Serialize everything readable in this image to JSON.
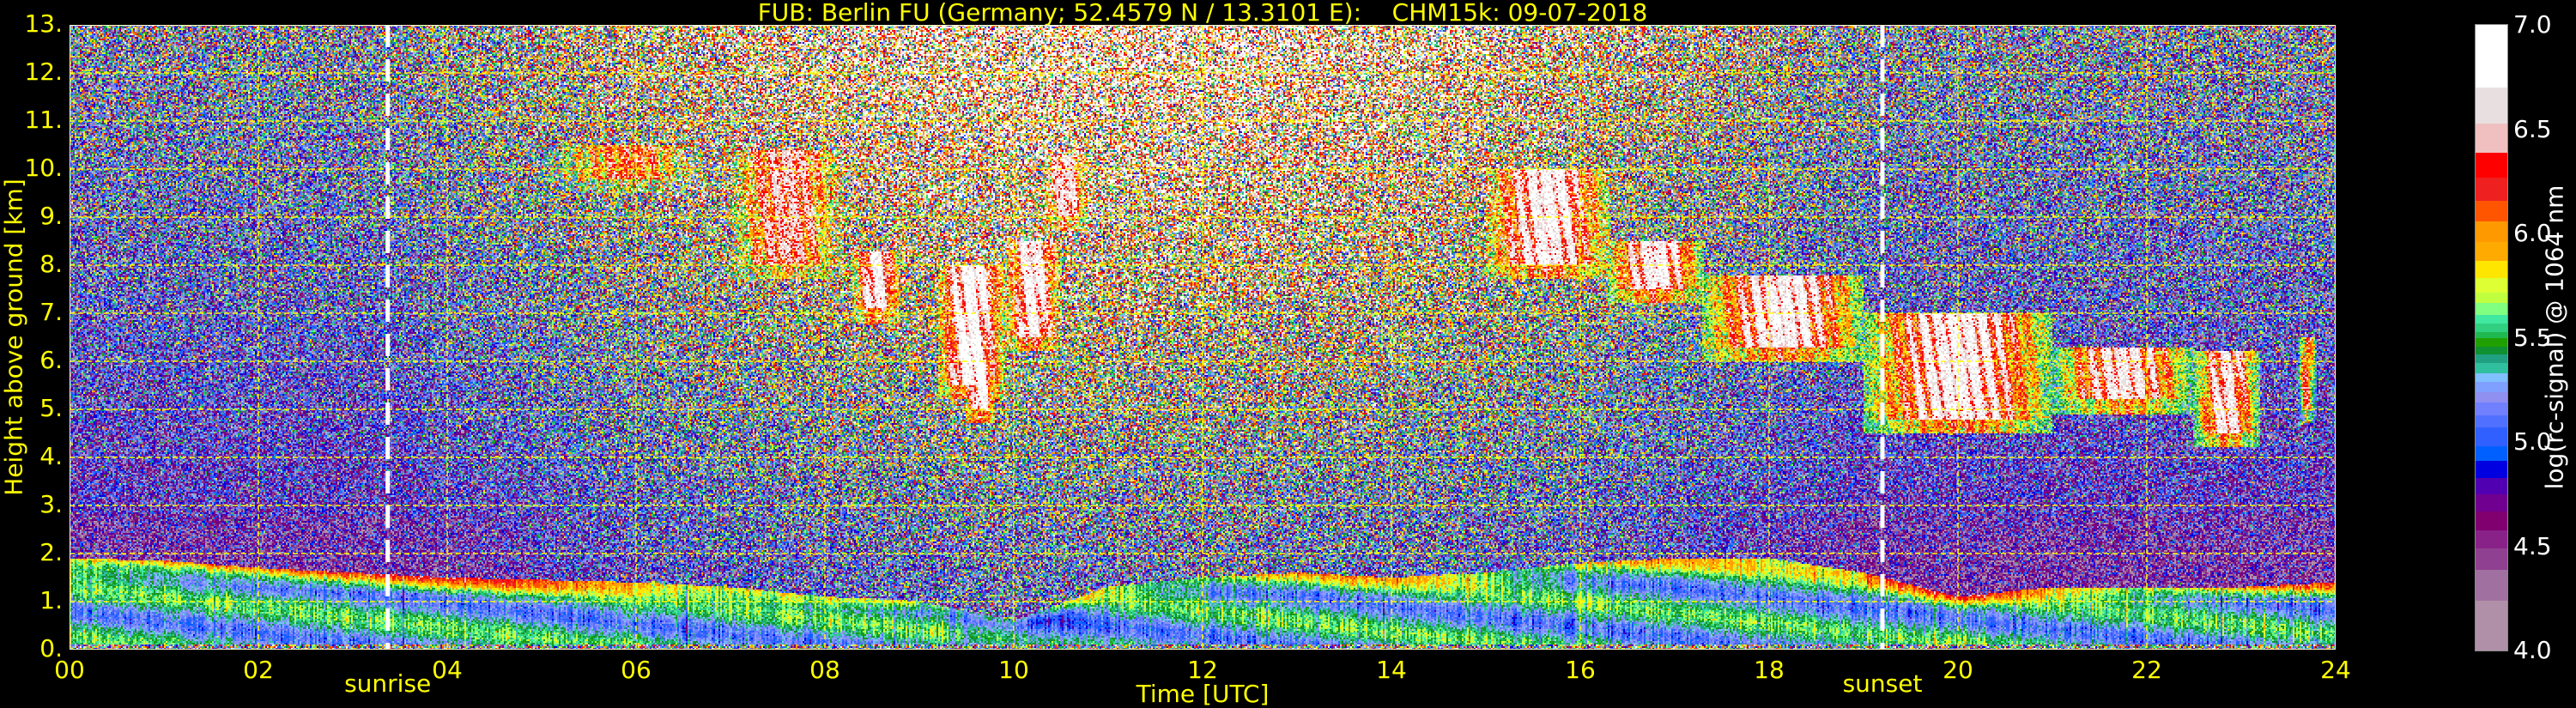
{
  "chart_data": {
    "type": "heatmap",
    "title": "FUB: Berlin FU (Germany; 52.4579 N / 13.3101 E):    CHM15k: 09-07-2018",
    "xlabel": "Time [UTC]",
    "ylabel": "Height above ground [km]",
    "xlim": [
      0,
      24
    ],
    "ylim": [
      0,
      13
    ],
    "grid": true,
    "grid_color": "#ffff00",
    "xticks": [
      {
        "value": 0,
        "label": "00"
      },
      {
        "value": 2,
        "label": "02"
      },
      {
        "value": 4,
        "label": "04"
      },
      {
        "value": 6,
        "label": "06"
      },
      {
        "value": 8,
        "label": "08"
      },
      {
        "value": 10,
        "label": "10"
      },
      {
        "value": 12,
        "label": "12"
      },
      {
        "value": 14,
        "label": "14"
      },
      {
        "value": 16,
        "label": "16"
      },
      {
        "value": 18,
        "label": "18"
      },
      {
        "value": 20,
        "label": "20"
      },
      {
        "value": 22,
        "label": "22"
      },
      {
        "value": 24,
        "label": "24"
      }
    ],
    "yticks": [
      {
        "value": 0,
        "label": "0."
      },
      {
        "value": 1,
        "label": "1."
      },
      {
        "value": 2,
        "label": "2."
      },
      {
        "value": 3,
        "label": "3."
      },
      {
        "value": 4,
        "label": "4."
      },
      {
        "value": 5,
        "label": "5."
      },
      {
        "value": 6,
        "label": "6."
      },
      {
        "value": 7,
        "label": "7."
      },
      {
        "value": 8,
        "label": "8."
      },
      {
        "value": 9,
        "label": "9."
      },
      {
        "value": 10,
        "label": "10."
      },
      {
        "value": 11,
        "label": "11."
      },
      {
        "value": 12,
        "label": "12."
      },
      {
        "value": 13,
        "label": "13."
      }
    ],
    "annotations": [
      {
        "label": "sunrise",
        "time_utc": 3.37,
        "line_color": "#ffffff"
      },
      {
        "label": "sunset",
        "time_utc": 19.2,
        "line_color": "#ffffff"
      }
    ],
    "colorbar": {
      "label": "log(rc-signal) @ 1064 nm",
      "range": [
        4.0,
        7.0
      ],
      "ticks": [
        {
          "value": 4.0,
          "label": "4.0"
        },
        {
          "value": 4.5,
          "label": "4.5"
        },
        {
          "value": 5.0,
          "label": "5.0"
        },
        {
          "value": 5.5,
          "label": "5.5"
        },
        {
          "value": 6.0,
          "label": "6.0"
        },
        {
          "value": 6.5,
          "label": "6.5"
        },
        {
          "value": 7.0,
          "label": "7.0"
        }
      ],
      "levels": [
        {
          "from": 4.0,
          "to": 4.24,
          "color": "#b090a8"
        },
        {
          "from": 4.24,
          "to": 4.39,
          "color": "#a070a0"
        },
        {
          "from": 4.39,
          "to": 4.49,
          "color": "#904090"
        },
        {
          "from": 4.49,
          "to": 4.58,
          "color": "#882288"
        },
        {
          "from": 4.58,
          "to": 4.67,
          "color": "#800070"
        },
        {
          "from": 4.67,
          "to": 4.75,
          "color": "#700090"
        },
        {
          "from": 4.75,
          "to": 4.83,
          "color": "#5000b0"
        },
        {
          "from": 4.83,
          "to": 4.91,
          "color": "#0000e0"
        },
        {
          "from": 4.91,
          "to": 4.98,
          "color": "#0060ff"
        },
        {
          "from": 4.98,
          "to": 5.07,
          "color": "#3060ff"
        },
        {
          "from": 5.07,
          "to": 5.13,
          "color": "#5070ff"
        },
        {
          "from": 5.13,
          "to": 5.19,
          "color": "#7080ff"
        },
        {
          "from": 5.19,
          "to": 5.24,
          "color": "#9090f0"
        },
        {
          "from": 5.24,
          "to": 5.29,
          "color": "#80a0ff"
        },
        {
          "from": 5.29,
          "to": 5.33,
          "color": "#80c0ff"
        },
        {
          "from": 5.33,
          "to": 5.38,
          "color": "#30c0a0"
        },
        {
          "from": 5.38,
          "to": 5.42,
          "color": "#20a080"
        },
        {
          "from": 5.42,
          "to": 5.46,
          "color": "#109030"
        },
        {
          "from": 5.46,
          "to": 5.5,
          "color": "#20a000"
        },
        {
          "from": 5.5,
          "to": 5.53,
          "color": "#20b850"
        },
        {
          "from": 5.53,
          "to": 5.57,
          "color": "#30d080"
        },
        {
          "from": 5.57,
          "to": 5.61,
          "color": "#40e8a0"
        },
        {
          "from": 5.61,
          "to": 5.67,
          "color": "#80ff80"
        },
        {
          "from": 5.67,
          "to": 5.72,
          "color": "#c0ff40"
        },
        {
          "from": 5.72,
          "to": 5.79,
          "color": "#ddff33"
        },
        {
          "from": 5.79,
          "to": 5.87,
          "color": "#ffe600"
        },
        {
          "from": 5.87,
          "to": 5.96,
          "color": "#ffaa00"
        },
        {
          "from": 5.96,
          "to": 6.06,
          "color": "#ff9900"
        },
        {
          "from": 6.06,
          "to": 6.16,
          "color": "#ff5500"
        },
        {
          "from": 6.16,
          "to": 6.27,
          "color": "#ee2020"
        },
        {
          "from": 6.27,
          "to": 6.39,
          "color": "#ff0000"
        },
        {
          "from": 6.39,
          "to": 6.53,
          "color": "#f0c0c0"
        },
        {
          "from": 6.53,
          "to": 6.7,
          "color": "#e8e0e0"
        },
        {
          "from": 6.7,
          "to": 7.0,
          "color": "#ffffff"
        }
      ]
    },
    "boundary_layer_top_km": {
      "time_utc": [
        0,
        1,
        2,
        3,
        4,
        5,
        6,
        7,
        8,
        9,
        10,
        11,
        12,
        13,
        14,
        15,
        16,
        17,
        18,
        19,
        20,
        21,
        22,
        23,
        24
      ],
      "height_km": [
        1.9,
        1.85,
        1.7,
        1.6,
        1.5,
        1.45,
        1.4,
        1.3,
        1.1,
        1.0,
        0.6,
        1.3,
        1.5,
        1.6,
        1.5,
        1.6,
        1.8,
        1.9,
        1.9,
        1.6,
        1.1,
        1.3,
        1.3,
        1.3,
        1.4
      ]
    },
    "cloud_features": [
      {
        "t0": 5.0,
        "t1": 6.8,
        "base_km": 9.8,
        "top_km": 10.5,
        "log_signal": 6.2
      },
      {
        "t0": 7.0,
        "t1": 8.2,
        "base_km": 8.0,
        "top_km": 10.4,
        "log_signal": 6.5
      },
      {
        "t0": 8.3,
        "t1": 8.8,
        "base_km": 7.1,
        "top_km": 8.3,
        "log_signal": 6.8
      },
      {
        "t0": 9.2,
        "t1": 9.9,
        "base_km": 5.5,
        "top_km": 8.0,
        "log_signal": 6.9
      },
      {
        "t0": 9.5,
        "t1": 9.8,
        "base_km": 5.0,
        "top_km": 6.0,
        "log_signal": 6.9
      },
      {
        "t0": 9.9,
        "t1": 10.5,
        "base_km": 6.5,
        "top_km": 8.5,
        "log_signal": 6.8
      },
      {
        "t0": 10.3,
        "t1": 10.8,
        "base_km": 9.0,
        "top_km": 10.3,
        "log_signal": 6.6
      },
      {
        "t0": 15.0,
        "t1": 16.3,
        "base_km": 8.0,
        "top_km": 10.0,
        "log_signal": 6.8
      },
      {
        "t0": 16.3,
        "t1": 17.3,
        "base_km": 7.5,
        "top_km": 8.5,
        "log_signal": 6.8
      },
      {
        "t0": 17.3,
        "t1": 19.0,
        "base_km": 6.3,
        "top_km": 7.8,
        "log_signal": 6.8
      },
      {
        "t0": 19.0,
        "t1": 21.0,
        "base_km": 4.8,
        "top_km": 7.0,
        "log_signal": 6.8
      },
      {
        "t0": 21.0,
        "t1": 22.5,
        "base_km": 5.2,
        "top_km": 6.3,
        "log_signal": 6.7
      },
      {
        "t0": 22.5,
        "t1": 23.2,
        "base_km": 4.5,
        "top_km": 6.2,
        "log_signal": 6.7
      },
      {
        "t0": 23.6,
        "t1": 23.8,
        "base_km": 5.0,
        "top_km": 6.5,
        "log_signal": 6.3
      }
    ]
  }
}
